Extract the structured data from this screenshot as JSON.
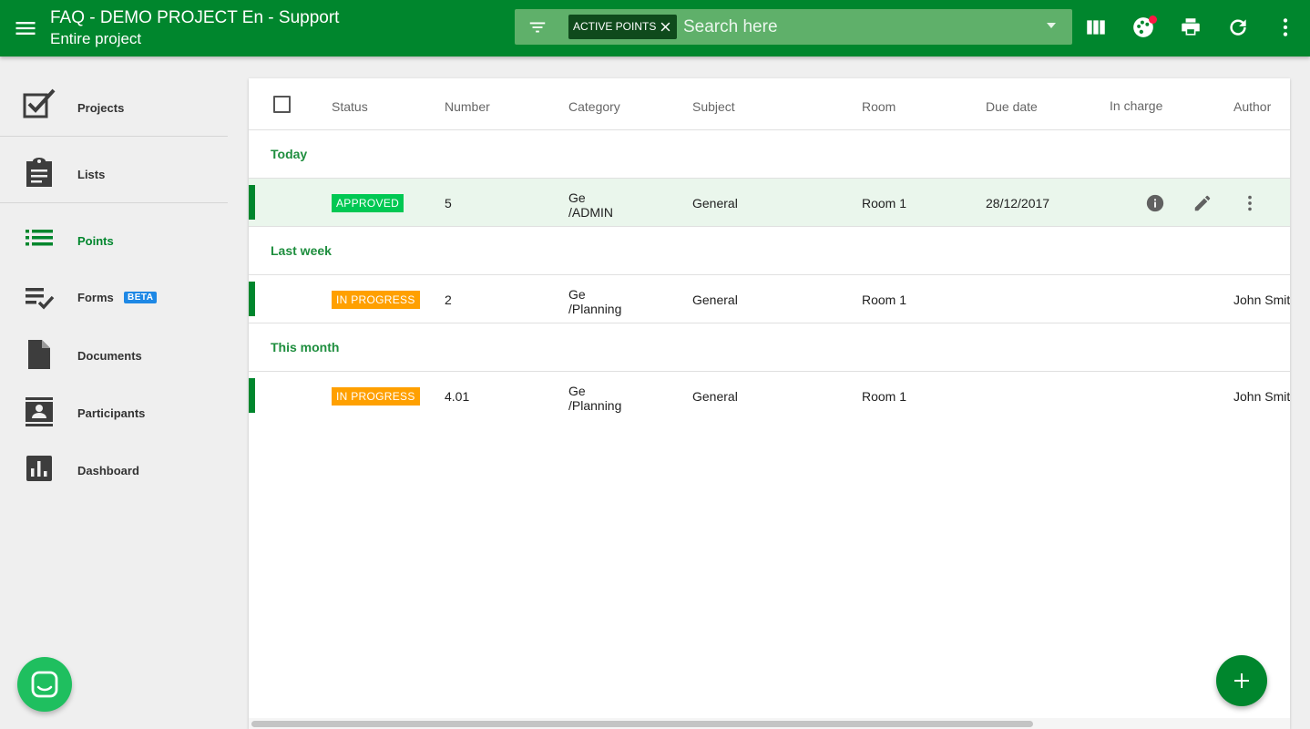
{
  "header": {
    "title": "FAQ - DEMO PROJECT En - Support",
    "subtitle": "Entire project",
    "search": {
      "chip_label": "ACTIVE POINTS",
      "placeholder": "Search here"
    }
  },
  "sidebar": {
    "items": [
      {
        "label": "Projects",
        "icon": "checkbox-icon"
      },
      {
        "label": "Lists",
        "icon": "clipboard-icon"
      },
      {
        "label": "Points",
        "icon": "list-icon"
      },
      {
        "label": "Forms",
        "icon": "checklist-icon",
        "badge": "BETA"
      },
      {
        "label": "Documents",
        "icon": "document-icon"
      },
      {
        "label": "Participants",
        "icon": "contact-card-icon"
      },
      {
        "label": "Dashboard",
        "icon": "bar-chart-icon"
      }
    ]
  },
  "table": {
    "columns": [
      "Status",
      "Number",
      "Category",
      "Subject",
      "Room",
      "Due date",
      "In charge",
      "Author"
    ],
    "groups": [
      {
        "label": "Today",
        "rows": [
          {
            "status": "APPROVED",
            "number": "5",
            "category_line1": "Ge",
            "category_line2": "/ADMIN",
            "subject": "General",
            "room": "Room 1",
            "due_date": "28/12/2017",
            "in_charge": "",
            "author": ""
          }
        ]
      },
      {
        "label": "Last week",
        "rows": [
          {
            "status": "IN PROGRESS",
            "number": "2",
            "category_line1": "Ge",
            "category_line2": "/Planning",
            "subject": "General",
            "room": "Room 1",
            "due_date": "",
            "in_charge": "",
            "author": "John Smit"
          }
        ]
      },
      {
        "label": "This month",
        "rows": [
          {
            "status": "IN PROGRESS",
            "number": "4.01",
            "category_line1": "Ge",
            "category_line2": "/Planning",
            "subject": "General",
            "room": "Room 1",
            "due_date": "",
            "in_charge": "",
            "author": "John Smit"
          }
        ]
      }
    ]
  },
  "colors": {
    "primary": "#00862d",
    "approved": "#00c853",
    "in_progress": "#ffa000",
    "beta": "#1e88e5",
    "row_highlight": "#eaf6ec"
  }
}
